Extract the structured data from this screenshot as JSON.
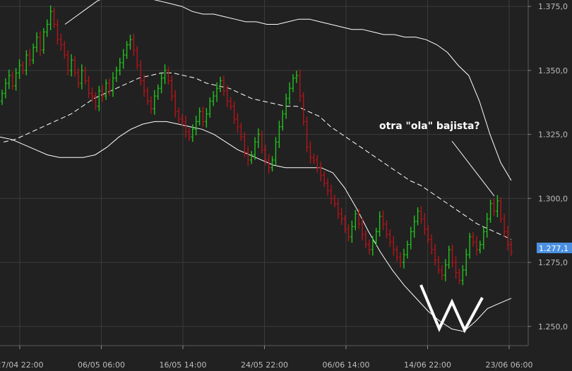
{
  "chart_data": {
    "type": "ohlc",
    "title": "",
    "y_ticks": [
      "1.375,0",
      "1.350,0",
      "1.325,0",
      "1.300,0",
      "1.275,0",
      "1.250,0"
    ],
    "x_ticks": [
      "27/04 22:00",
      "06/05 06:00",
      "16/05 14:00",
      "24/05 22:00",
      "06/06 14:00",
      "14/06 22:00",
      "23/06 06:00"
    ],
    "ylim": [
      1.2425,
      1.3775
    ],
    "last_price": "1.277,1",
    "annotation": "otra \"ola\" bajista?",
    "grid": true,
    "colors": {
      "background": "#212121",
      "grid": "#3a3a3a",
      "bar_up": "#22c21e",
      "bar_down": "#b3141a",
      "bands": "#ffffff",
      "price_tag": "#4a90e2",
      "text": "#bdbdbd"
    },
    "closes": [
      1.341,
      1.345,
      1.348,
      1.344,
      1.349,
      1.352,
      1.35,
      1.356,
      1.354,
      1.359,
      1.363,
      1.358,
      1.365,
      1.368,
      1.373,
      1.368,
      1.362,
      1.36,
      1.356,
      1.35,
      1.354,
      1.349,
      1.345,
      1.35,
      1.346,
      1.341,
      1.34,
      1.336,
      1.342,
      1.34,
      1.345,
      1.342,
      1.347,
      1.35,
      1.353,
      1.356,
      1.36,
      1.362,
      1.358,
      1.352,
      1.346,
      1.342,
      1.338,
      1.335,
      1.34,
      1.343,
      1.347,
      1.35,
      1.346,
      1.34,
      1.334,
      1.331,
      1.33,
      1.326,
      1.324,
      1.327,
      1.33,
      1.334,
      1.33,
      1.333,
      1.338,
      1.34,
      1.343,
      1.346,
      1.342,
      1.338,
      1.336,
      1.331,
      1.328,
      1.324,
      1.318,
      1.315,
      1.317,
      1.322,
      1.325,
      1.319,
      1.315,
      1.312,
      1.315,
      1.322,
      1.328,
      1.333,
      1.339,
      1.343,
      1.347,
      1.348,
      1.34,
      1.33,
      1.32,
      1.316,
      1.315,
      1.312,
      1.309,
      1.306,
      1.303,
      1.3,
      1.298,
      1.294,
      1.292,
      1.288,
      1.285,
      1.289,
      1.294,
      1.29,
      1.286,
      1.282,
      1.28,
      1.283,
      1.287,
      1.293,
      1.29,
      1.286,
      1.283,
      1.28,
      1.277,
      1.275,
      1.278,
      1.282,
      1.287,
      1.291,
      1.295,
      1.292,
      1.288,
      1.284,
      1.28,
      1.276,
      1.272,
      1.27,
      1.274,
      1.28,
      1.275,
      1.271,
      1.268,
      1.272,
      1.278,
      1.285,
      1.283,
      1.28,
      1.282,
      1.287,
      1.292,
      1.298,
      1.295,
      1.299,
      1.292,
      1.287,
      1.282,
      1.279
    ],
    "upper_band": [
      1.368,
      1.371,
      1.374,
      1.377,
      1.379,
      1.38,
      1.38,
      1.379,
      1.378,
      1.377,
      1.376,
      1.375,
      1.373,
      1.372,
      1.372,
      1.371,
      1.37,
      1.369,
      1.369,
      1.368,
      1.368,
      1.369,
      1.37,
      1.37,
      1.369,
      1.368,
      1.367,
      1.366,
      1.366,
      1.365,
      1.364,
      1.364,
      1.363,
      1.363,
      1.362,
      1.36,
      1.357,
      1.352,
      1.348,
      1.338,
      1.325,
      1.314,
      1.307
    ],
    "lower_band": [
      1.324,
      1.323,
      1.321,
      1.319,
      1.317,
      1.316,
      1.316,
      1.316,
      1.317,
      1.32,
      1.324,
      1.327,
      1.329,
      1.33,
      1.33,
      1.329,
      1.328,
      1.327,
      1.325,
      1.322,
      1.319,
      1.317,
      1.315,
      1.313,
      1.312,
      1.312,
      1.312,
      1.312,
      1.31,
      1.304,
      1.296,
      1.287,
      1.279,
      1.272,
      1.266,
      1.261,
      1.256,
      1.252,
      1.249,
      1.248,
      1.252,
      1.257,
      1.259,
      1.261
    ],
    "middle_band": [
      1.322,
      1.323,
      1.325,
      1.327,
      1.329,
      1.331,
      1.333,
      1.336,
      1.339,
      1.341,
      1.343,
      1.345,
      1.347,
      1.348,
      1.349,
      1.349,
      1.348,
      1.347,
      1.345,
      1.344,
      1.343,
      1.341,
      1.339,
      1.338,
      1.337,
      1.336,
      1.336,
      1.334,
      1.332,
      1.328,
      1.325,
      1.322,
      1.319,
      1.316,
      1.313,
      1.31,
      1.307,
      1.305,
      1.302,
      1.299,
      1.296,
      1.293,
      1.29,
      1.288,
      1.286,
      1.284
    ]
  }
}
